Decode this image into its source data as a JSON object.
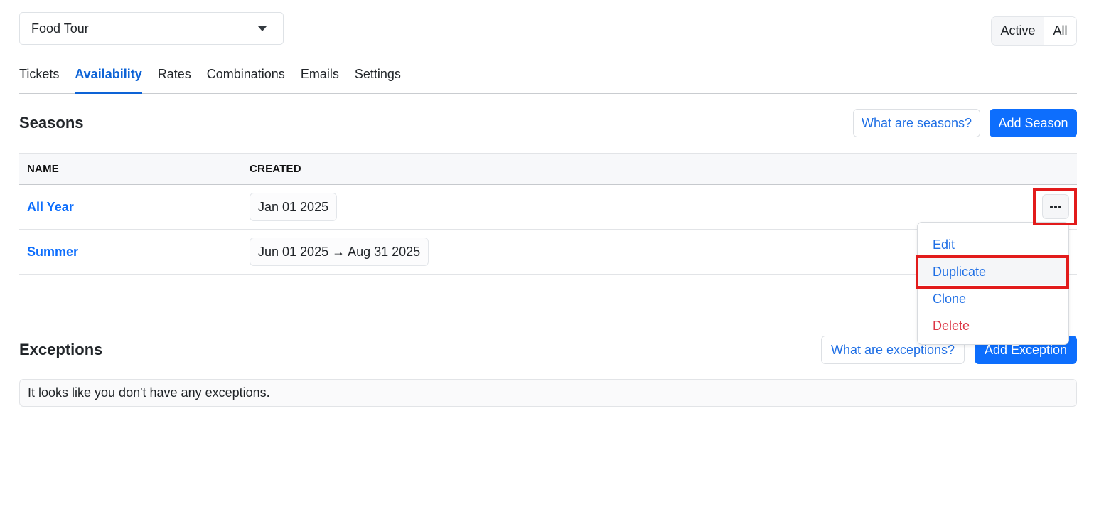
{
  "product_select": {
    "value": "Food Tour",
    "icon": "caret-down-icon"
  },
  "filter_toggle": {
    "options": [
      "Active",
      "All"
    ],
    "selected": "Active"
  },
  "tabs": [
    {
      "label": "Tickets",
      "selected": false
    },
    {
      "label": "Availability",
      "selected": true
    },
    {
      "label": "Rates",
      "selected": false
    },
    {
      "label": "Combinations",
      "selected": false
    },
    {
      "label": "Emails",
      "selected": false
    },
    {
      "label": "Settings",
      "selected": false
    }
  ],
  "seasons": {
    "title": "Seasons",
    "help_button": "What are seasons?",
    "add_button": "Add Season",
    "columns": [
      "NAME",
      "CREATED"
    ],
    "rows": [
      {
        "name": "All Year",
        "created": "Jan 01 2025"
      },
      {
        "name": "Summer",
        "created": "Jun 01 2025 → Aug 31 2025"
      }
    ],
    "row_menu": {
      "icon": "more-horizontal-icon",
      "items": [
        {
          "label": "Edit",
          "variant": "default"
        },
        {
          "label": "Duplicate",
          "variant": "default",
          "hovered": true
        },
        {
          "label": "Clone",
          "variant": "default"
        },
        {
          "label": "Delete",
          "variant": "danger"
        }
      ]
    }
  },
  "exceptions": {
    "title": "Exceptions",
    "help_button": "What are exceptions?",
    "add_button": "Add Exception",
    "empty_message": "It looks like you don't have any exceptions."
  },
  "colors": {
    "primary": "#0d6efd",
    "link": "#1f6fe5",
    "tab_active": "#0d63d6",
    "danger": "#dc3545",
    "annotation": "#e21b1b"
  }
}
